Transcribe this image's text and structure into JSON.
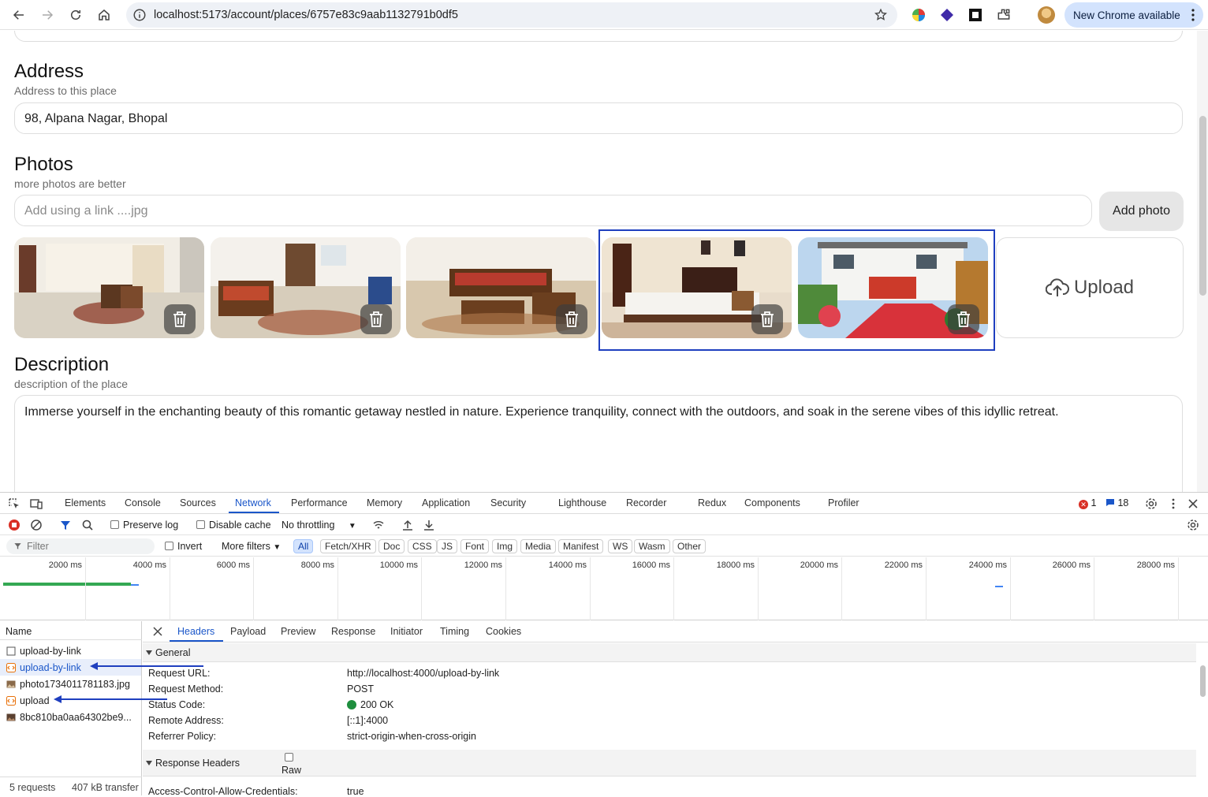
{
  "browser": {
    "url": "localhost:5173/account/places/6757e83c9aab1132791b0df5",
    "update_label": "New Chrome available"
  },
  "form": {
    "address": {
      "title": "Address",
      "subtitle": "Address to this place",
      "value": "98, Alpana Nagar, Bhopal"
    },
    "photos": {
      "title": "Photos",
      "subtitle": "more photos are better",
      "placeholder": "Add using a link ....jpg",
      "add_label": "Add photo",
      "upload_label": "Upload"
    },
    "description": {
      "title": "Description",
      "subtitle": "description of the place",
      "value": "Immerse yourself in the enchanting beauty of this romantic getaway nestled in nature. Experience tranquility, connect with the outdoors, and soak in the serene vibes of this idyllic retreat."
    }
  },
  "devtools": {
    "tabs": [
      "Elements",
      "Console",
      "Sources",
      "Network",
      "Performance",
      "Memory",
      "Application",
      "Security",
      "Lighthouse",
      "Recorder",
      "Redux",
      "Components",
      "Profiler"
    ],
    "active_tab": "Network",
    "error_count": "1",
    "message_count": "18",
    "toolbar": {
      "preserve_log": "Preserve log",
      "disable_cache": "Disable cache",
      "throttling": "No throttling"
    },
    "filter": {
      "placeholder": "Filter",
      "invert": "Invert",
      "more_filters": "More filters",
      "types": [
        "All",
        "Fetch/XHR",
        "Doc",
        "CSS",
        "JS",
        "Font",
        "Img",
        "Media",
        "Manifest",
        "WS",
        "Wasm",
        "Other"
      ],
      "active_type": "All"
    },
    "timeline": {
      "ticks": [
        "2000 ms",
        "4000 ms",
        "6000 ms",
        "8000 ms",
        "10000 ms",
        "12000 ms",
        "14000 ms",
        "16000 ms",
        "18000 ms",
        "20000 ms",
        "22000 ms",
        "24000 ms",
        "26000 ms",
        "28000 ms"
      ]
    },
    "requests": {
      "header": "Name",
      "items": [
        {
          "name": "upload-by-link",
          "kind": "doc"
        },
        {
          "name": "upload-by-link",
          "kind": "xhr"
        },
        {
          "name": "photo1734011781183.jpg",
          "kind": "img"
        },
        {
          "name": "upload",
          "kind": "xhr"
        },
        {
          "name": "8bc810ba0aa64302be9...",
          "kind": "img"
        }
      ],
      "summary_count": "5 requests",
      "summary_size": "407 kB transfer"
    },
    "details": {
      "tabs": [
        "Headers",
        "Payload",
        "Preview",
        "Response",
        "Initiator",
        "Timing",
        "Cookies"
      ],
      "active_tab": "Headers",
      "general_title": "General",
      "general": [
        {
          "key": "Request URL:",
          "value": "http://localhost:4000/upload-by-link"
        },
        {
          "key": "Request Method:",
          "value": "POST"
        },
        {
          "key": "Status Code:",
          "value": "200 OK"
        },
        {
          "key": "Remote Address:",
          "value": "[::1]:4000"
        },
        {
          "key": "Referrer Policy:",
          "value": "strict-origin-when-cross-origin"
        }
      ],
      "response_title": "Response Headers",
      "raw_label": "Raw",
      "partial_key": "Access-Control-Allow-Credentials:",
      "partial_value": "true"
    }
  },
  "colors": {
    "accent": "#1a56c9",
    "highlight_box": "#1f3fbf",
    "status_ok": "#1e8e3e",
    "error": "#d93025"
  }
}
